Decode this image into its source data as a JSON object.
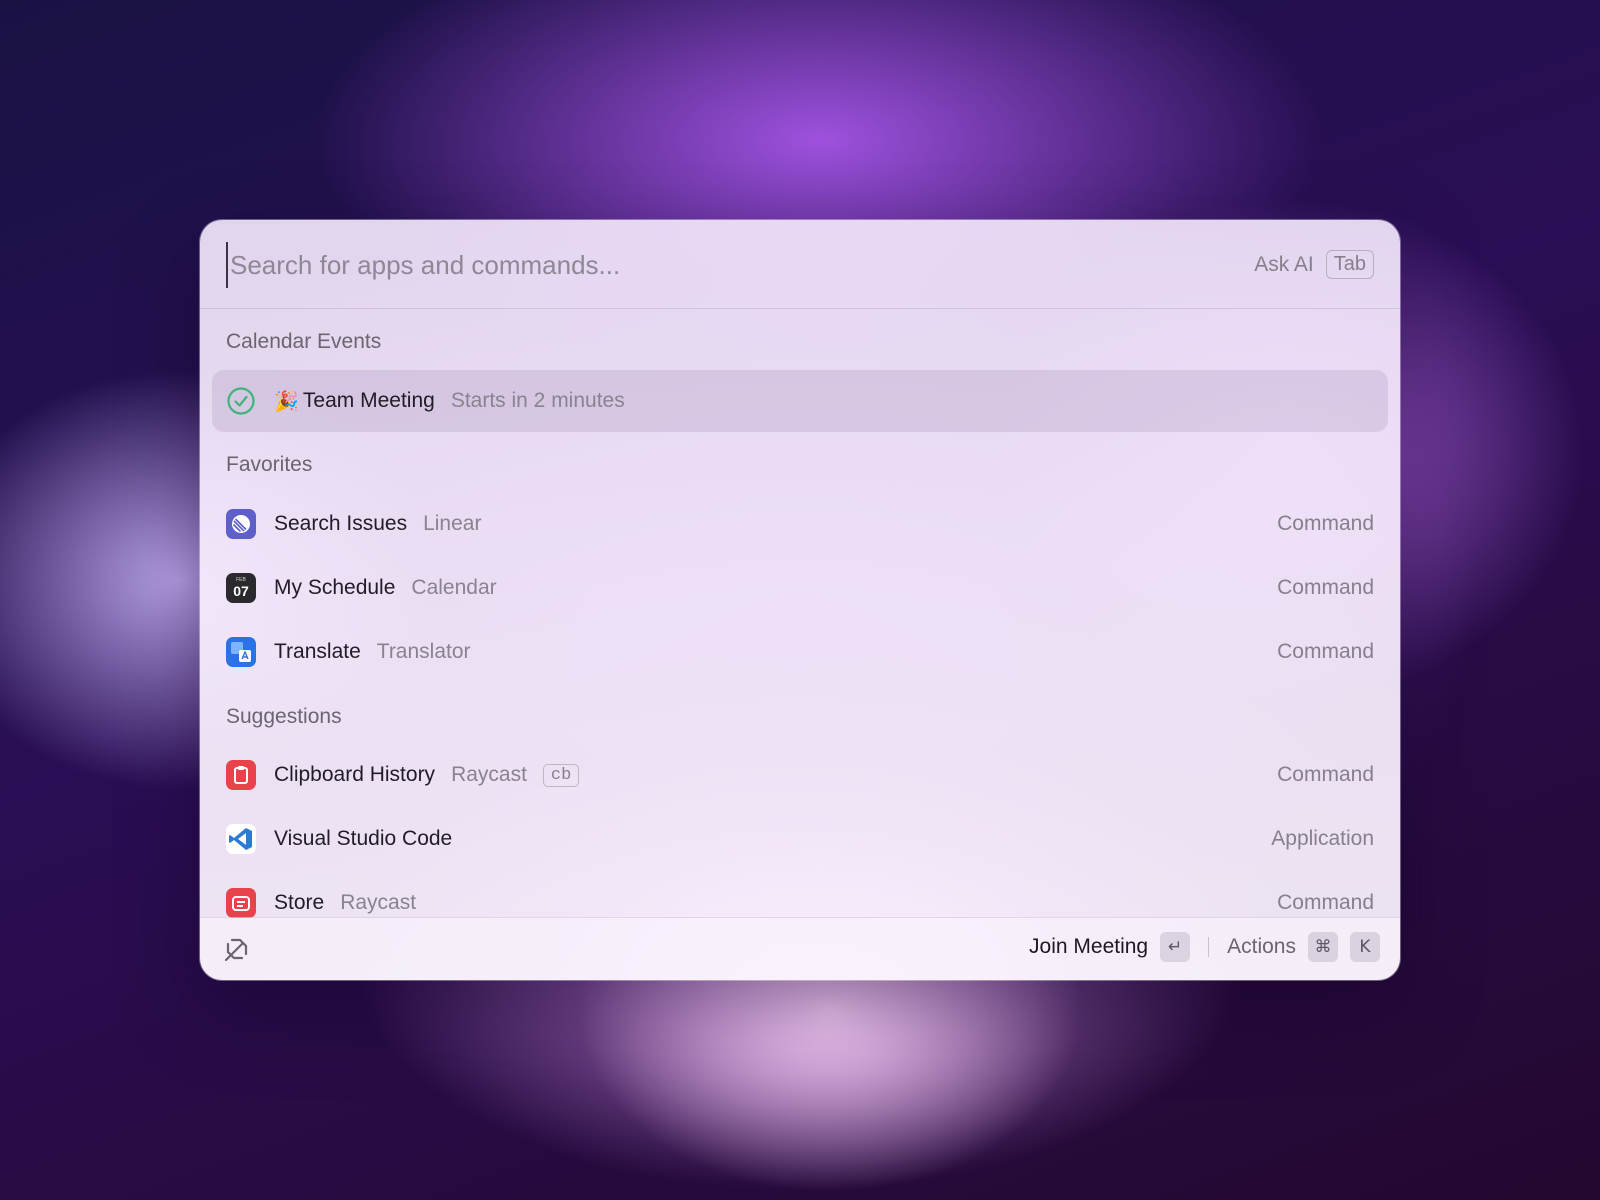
{
  "search": {
    "placeholder": "Search for apps and commands...",
    "ask_ai_label": "Ask AI",
    "ask_ai_key": "Tab"
  },
  "sections": {
    "calendar": "Calendar Events",
    "favorites": "Favorites",
    "suggestions": "Suggestions"
  },
  "calendar_item": {
    "emoji": "🎉",
    "title": "Team Meeting",
    "subtitle": "Starts in 2 minutes",
    "icon": "check-circle-icon"
  },
  "favorites": [
    {
      "title": "Search Issues",
      "subtitle": "Linear",
      "accessory": "Command",
      "icon": "linear-icon"
    },
    {
      "title": "My Schedule",
      "subtitle": "Calendar",
      "accessory": "Command",
      "icon": "calendar-icon",
      "icon_month": "FEB",
      "icon_day": "07"
    },
    {
      "title": "Translate",
      "subtitle": "Translator",
      "accessory": "Command",
      "icon": "translator-icon"
    }
  ],
  "suggestions": [
    {
      "title": "Clipboard History",
      "subtitle": "Raycast",
      "alias": "cb",
      "accessory": "Command",
      "icon": "clipboard-icon"
    },
    {
      "title": "Visual Studio Code",
      "subtitle": "",
      "accessory": "Application",
      "icon": "vscode-icon"
    },
    {
      "title": "Store",
      "subtitle": "Raycast",
      "accessory": "Command",
      "icon": "store-icon"
    }
  ],
  "footer": {
    "primary_action": "Join Meeting",
    "primary_key": "↵",
    "secondary_action": "Actions",
    "secondary_keys": [
      "⌘",
      "K"
    ]
  },
  "colors": {
    "accent_green": "#3fb37a",
    "linear": "#5e5fc9",
    "translator": "#2a72e6",
    "raycast_red": "#e8434a",
    "vscode_blue": "#2a7bd6"
  }
}
